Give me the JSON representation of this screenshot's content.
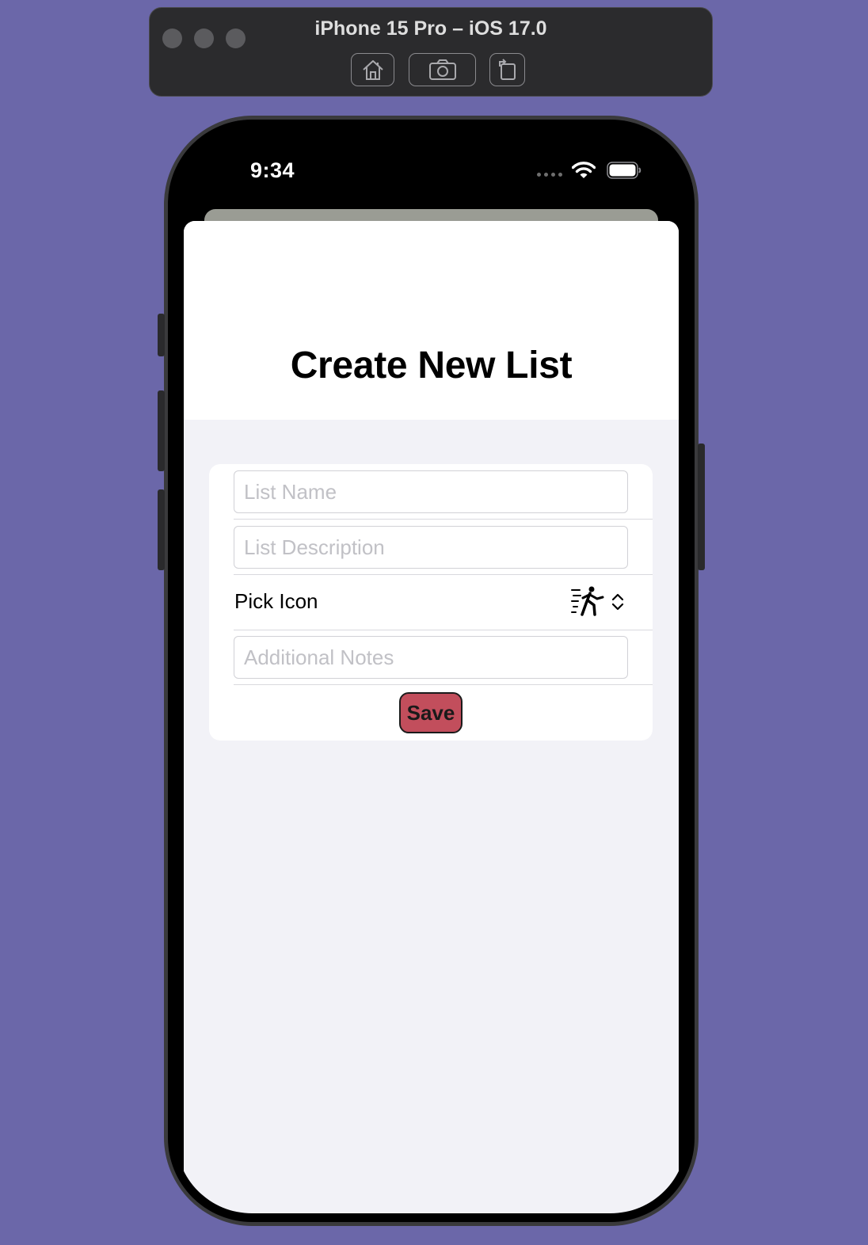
{
  "simulator": {
    "title": "iPhone 15 Pro – iOS 17.0",
    "buttons": [
      "home-icon",
      "screenshot-icon",
      "rotate-icon"
    ]
  },
  "status_bar": {
    "time": "9:34",
    "icons": [
      "cellular-dots-icon",
      "wifi-icon",
      "battery-icon"
    ]
  },
  "page": {
    "title": "Create New List"
  },
  "form": {
    "list_name_placeholder": "List Name",
    "list_description_placeholder": "List Description",
    "pick_icon_label": "Pick Icon",
    "selected_icon": "figure-run-icon",
    "notes_placeholder": "Additional Notes",
    "save_label": "Save"
  },
  "colors": {
    "desktop_background": "#6b67a9",
    "save_button": "#c24e5c",
    "form_background": "#f2f2f7"
  }
}
